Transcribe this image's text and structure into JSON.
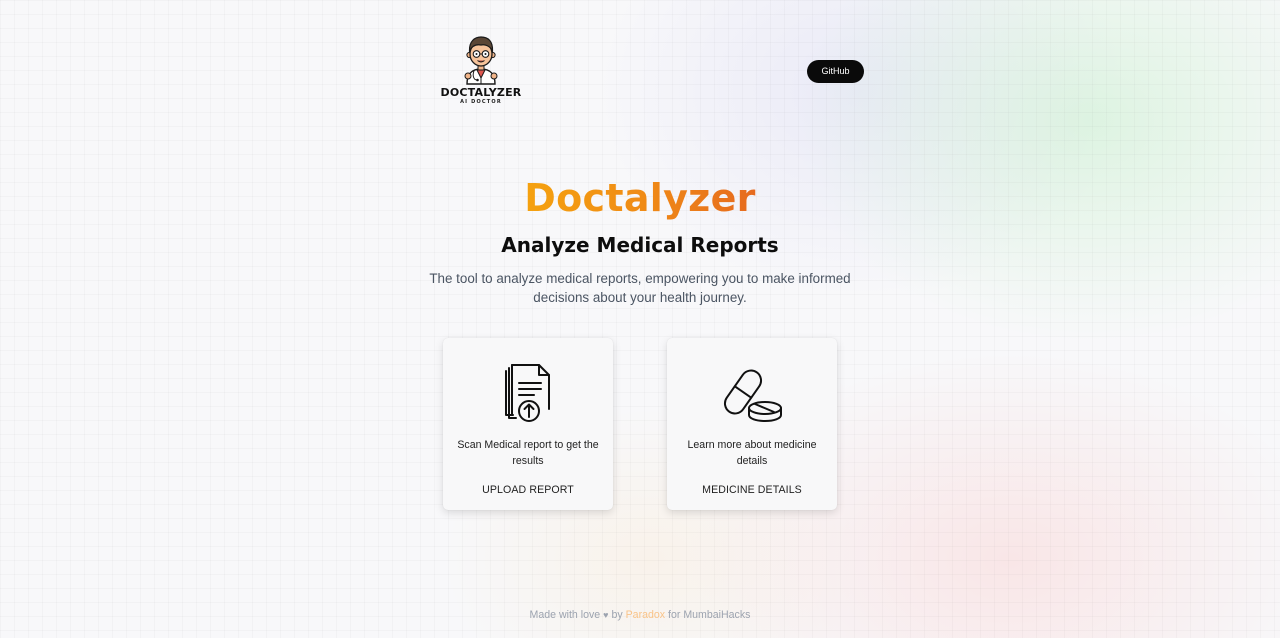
{
  "header": {
    "logo": {
      "title": "DOCTALYZER",
      "subtitle": "AI DOCTOR",
      "icon": "doctor-avatar-icon"
    },
    "github_label": "GitHub"
  },
  "hero": {
    "title": "Doctalyzer",
    "subtitle": "Analyze Medical Reports",
    "description": "The tool to analyze medical reports, empowering you to make informed decisions about your health journey."
  },
  "cards": [
    {
      "icon": "document-upload-icon",
      "description": "Scan Medical report to get the results",
      "action": "UPLOAD REPORT"
    },
    {
      "icon": "medicine-pills-icon",
      "description": "Learn more about medicine details",
      "action": "MEDICINE DETAILS"
    }
  ],
  "footer": {
    "prefix": "Made with love",
    "heart": "♥",
    "by": "by",
    "author": "Paradox",
    "for": "for MumbaiHacks"
  },
  "colors": {
    "title_gradient_start": "#f5a20f",
    "title_gradient_end": "#e66a1f",
    "github_button": "#0a0a0a",
    "footer_accent": "#f9c388"
  }
}
